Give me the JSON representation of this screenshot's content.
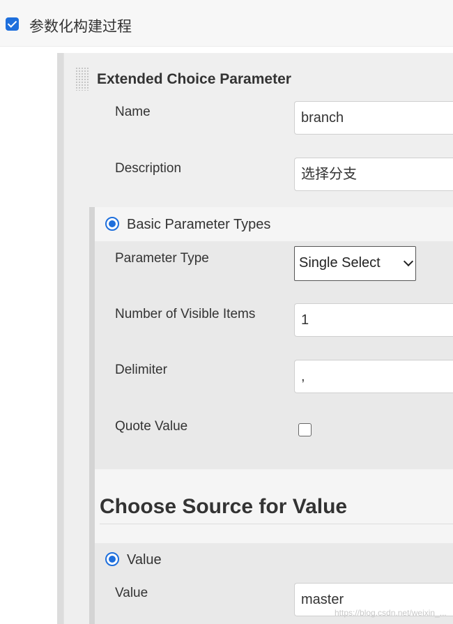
{
  "header": {
    "checkbox_label": "参数化构建过程",
    "checkbox_checked": true
  },
  "parameter": {
    "title": "Extended Choice Parameter",
    "name_label": "Name",
    "name_value": "branch",
    "description_label": "Description",
    "description_value": "选择分支"
  },
  "basic": {
    "radio_label": "Basic Parameter Types",
    "radio_selected": true,
    "type_label": "Parameter Type",
    "type_value": "Single Select",
    "visible_items_label": "Number of Visible Items",
    "visible_items_value": "1",
    "delimiter_label": "Delimiter",
    "delimiter_value": ",",
    "quote_label": "Quote Value",
    "quote_checked": false
  },
  "source": {
    "heading": "Choose Source for Value",
    "radio_label": "Value",
    "radio_selected": true,
    "value_label": "Value",
    "value_value": "master"
  },
  "watermark": "https://blog.csdn.net/weixin_...",
  "colors": {
    "accent": "#1e6fdc"
  }
}
